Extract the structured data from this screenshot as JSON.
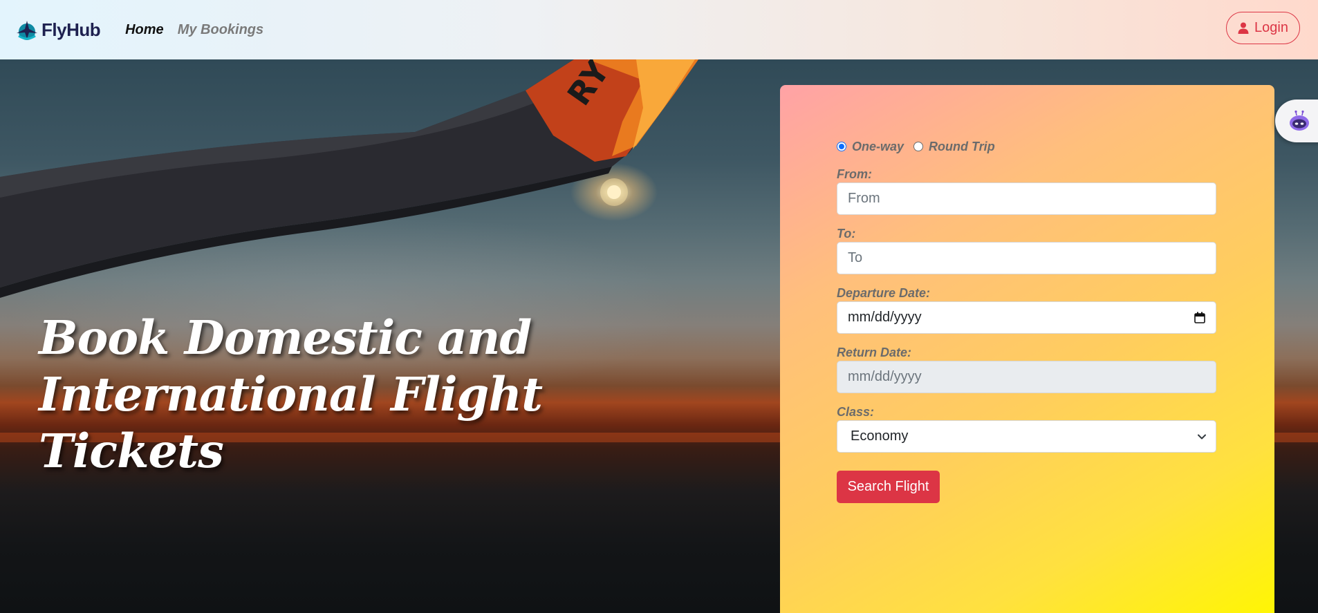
{
  "navbar": {
    "brand_name": "FlyHub",
    "links": [
      {
        "label": "Home",
        "active": true
      },
      {
        "label": "My Bookings",
        "active": false
      }
    ],
    "login_label": "Login"
  },
  "hero": {
    "title_line1": "Book Domestic and",
    "title_line2": "International Flight Tickets"
  },
  "booking_form": {
    "trip_type": {
      "one_way_label": "One-way",
      "round_trip_label": "Round Trip",
      "selected": "One-way"
    },
    "from": {
      "label": "From:",
      "placeholder": "From"
    },
    "to": {
      "label": "To:",
      "placeholder": "To"
    },
    "departure": {
      "label": "Departure Date:",
      "placeholder": "mm/dd/yyyy"
    },
    "return": {
      "label": "Return Date:",
      "placeholder": "mm/dd/yyyy",
      "disabled": true
    },
    "class": {
      "label": "Class:",
      "selected": "Economy"
    },
    "search_label": "Search Flight"
  },
  "colors": {
    "accent_red": "#dc3545",
    "brand_navy": "#1e2150",
    "radio_blue": "#0d6efd"
  },
  "icons": {
    "brand": "plane-logo-icon",
    "login": "user-icon",
    "calendar": "calendar-icon",
    "select": "chevron-down-icon",
    "bot": "robot-icon"
  }
}
